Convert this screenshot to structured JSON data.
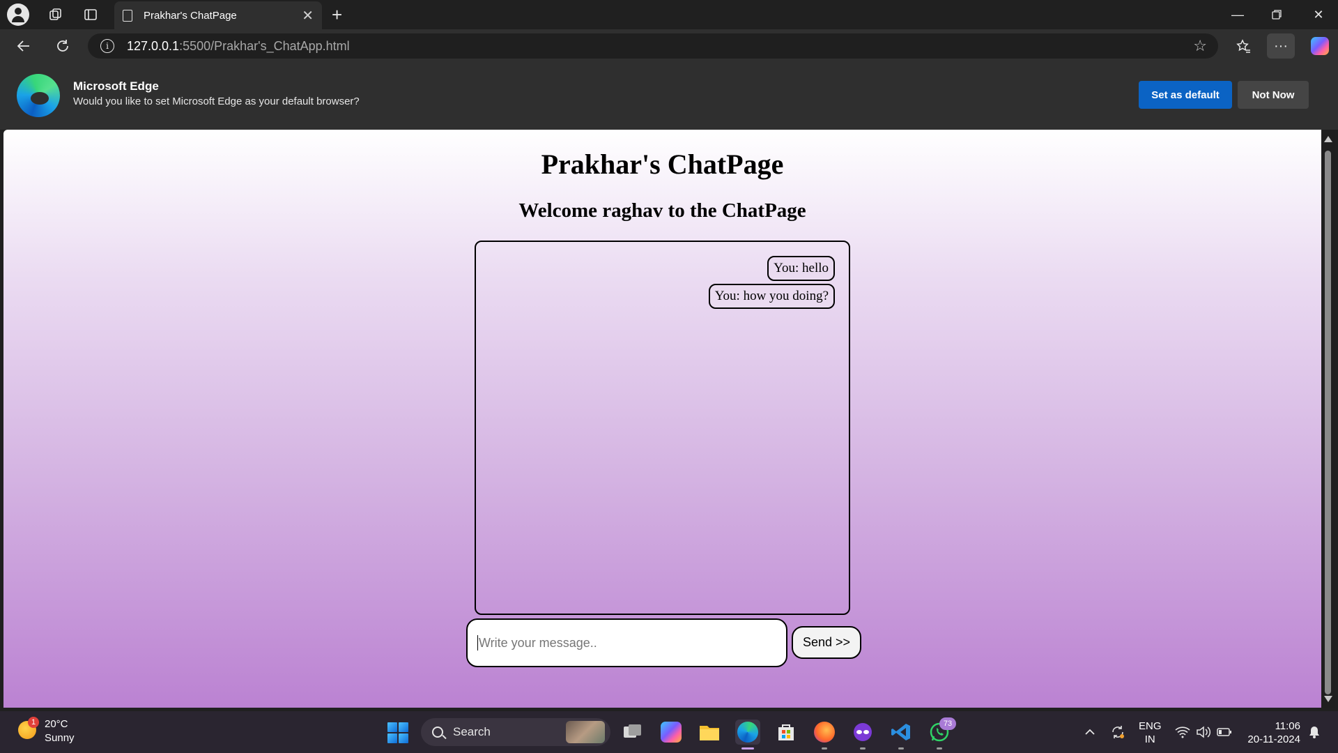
{
  "browser": {
    "tab_title": "Prakhar's ChatPage",
    "url_host": "127.0.0.1",
    "url_path": ":5500/Prakhar's_ChatApp.html",
    "icons": [
      "profile-icon",
      "workspaces-icon",
      "vertical-tabs-icon",
      "page-icon",
      "close-tab-icon",
      "new-tab-icon",
      "minimize-icon",
      "restore-icon",
      "close-window-icon",
      "back-icon",
      "refresh-icon",
      "info-icon",
      "favorite-star-icon",
      "favorites-icon",
      "more-icon",
      "copilot-icon"
    ]
  },
  "infobar": {
    "title": "Microsoft Edge",
    "message": "Would you like to set Microsoft Edge as your default browser?",
    "set_default_label": "Set as default",
    "not_now_label": "Not Now"
  },
  "page": {
    "title": "Prakhar's ChatPage",
    "subtitle": "Welcome raghav to the ChatPage",
    "messages": [
      {
        "text": "You: hello"
      },
      {
        "text": "You: how you doing?"
      }
    ],
    "input_placeholder": "Write your message..",
    "input_value": "",
    "send_label": "Send >>"
  },
  "taskbar": {
    "weather_badge": "1",
    "weather_temp": "20°C",
    "weather_condition": "Sunny",
    "search_label": "Search",
    "whatsapp_badge": "73",
    "lang_top": "ENG",
    "lang_bottom": "IN",
    "time": "11:06",
    "date": "20-11-2024"
  },
  "colors": {
    "primary_button": "#0b63c4",
    "page_gradient_top": "#ffffff",
    "page_gradient_bottom": "#bb82d2"
  }
}
